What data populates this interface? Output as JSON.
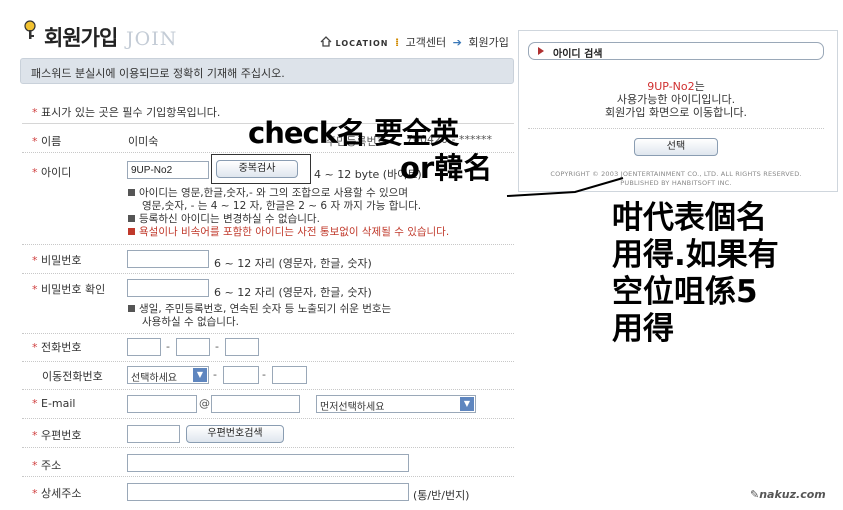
{
  "header": {
    "title_kr": "회원가입",
    "title_en": "JOIN",
    "location_label": "LOCATION",
    "crumb_1": "고객센터",
    "crumb_2": "회원가입"
  },
  "notice": "패스워드 분실시에 이용되므로 정확히 기재해 주십시오.",
  "required_note": "표시가 있는 곳은 필수 기입항목입니다.",
  "form": {
    "name": {
      "label": "이름",
      "value": "이미숙",
      "ssn_label": "주민등록번호",
      "ssn_value": "700420 - ******"
    },
    "userid": {
      "label": "아이디",
      "value": "9UP-No2",
      "check_button": "중복검사",
      "hint": "4 ~ 12 byte (바이트)",
      "info_1a": "아이디는 영문,한글,숫자,- 와 그의 조합으로 사용할 수 있으며",
      "info_1b": "영문,숫자, - 는 4 ~ 12 자, 한글은 2 ~ 6 자 까지 가능 합니다.",
      "info_2": "등록하신 아이디는 변경하실 수 없습니다.",
      "info_3": "욕설이나 비속어를 포함한 아이디는 사전 통보없이 삭제될 수 있습니다."
    },
    "password": {
      "label": "비밀번호",
      "hint": "6 ~ 12 자리 (영문자, 한글, 숫자)"
    },
    "password_confirm": {
      "label": "비밀번호 확인",
      "hint": "6 ~ 12 자리 (영문자, 한글, 숫자)",
      "info_a": "생일, 주민등록번호, 연속된 숫자 등 노출되기 쉬운 번호는",
      "info_b": "사용하실 수 없습니다."
    },
    "phone": {
      "label": "전화번호",
      "dash": "-"
    },
    "mobile": {
      "label": "이동전화번호",
      "select": "선택하세요",
      "dash": "-"
    },
    "email": {
      "label": "E-mail",
      "at": "@",
      "domain_select": "먼저선택하세요"
    },
    "zip": {
      "label": "우편번호",
      "search_button": "우편번호검색"
    },
    "address": {
      "label": "주소"
    },
    "address_detail": {
      "label": "상세주소",
      "hint": "(통/반/번지)"
    }
  },
  "popup": {
    "title": "아이디 검색",
    "checked_id": "9UP-No2",
    "msg_suffix": "는",
    "msg_2": "사용가능한 아이디입니다.",
    "msg_3": "회원가입 화면으로 이동합니다.",
    "select_button": "선택",
    "copyright_1": "COPYRIGHT © 2003 JOENTERTAINMENT CO., LTD. ALL RIGHTS RESERVED.",
    "copyright_2": "PUBLISHED BY HANBITSOFT INC."
  },
  "annotations": {
    "note_1a": "check名 要全英",
    "note_1b": "or韓名",
    "note_2a": "咁代表個名",
    "note_2b": "用得.如果有",
    "note_2c": "空位咀係5",
    "note_2d": "用得"
  },
  "watermark": "nakuz.com",
  "colors": {
    "required_star": "#d04040",
    "warning_text": "#c0392b",
    "notice_bg": "#dde3ea",
    "select_arrow": "#5f86bf"
  }
}
